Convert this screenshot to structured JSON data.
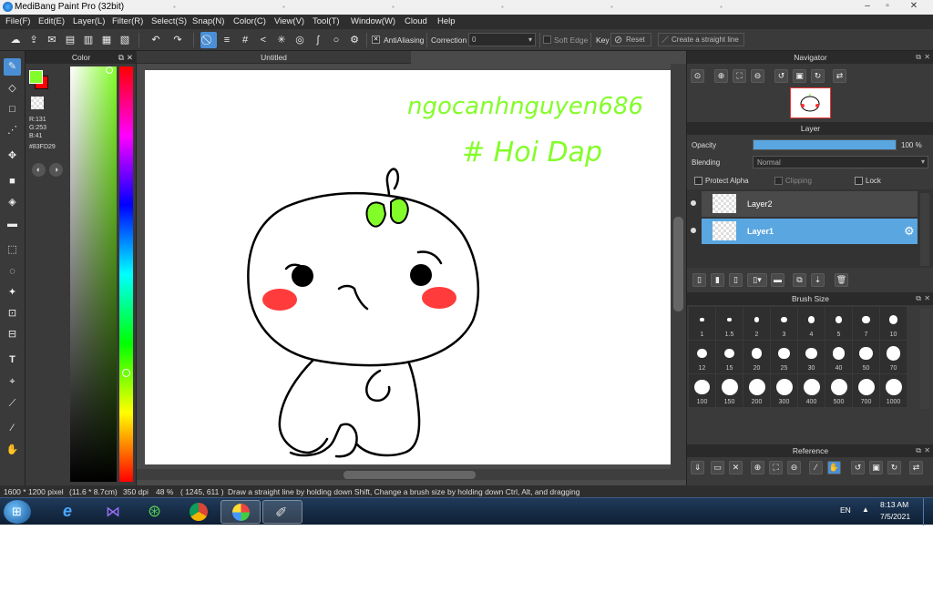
{
  "window": {
    "title": "MediBang Paint Pro (32bit)"
  },
  "menu": [
    "File(F)",
    "Edit(E)",
    "Layer(L)",
    "Filter(R)",
    "Select(S)",
    "Snap(N)",
    "Color(C)",
    "View(V)",
    "Tool(T)",
    "Window(W)",
    "Cloud",
    "Help"
  ],
  "toolbar": {
    "antialiasing_label": "AntiAliasing",
    "correction_label": "Correction",
    "correction_value": "0",
    "soft_edge_label": "Soft Edge",
    "key_label": "Key",
    "reset_label": "Reset",
    "straight_line_label": "Create a straight line"
  },
  "color_panel": {
    "title": "Color",
    "r": "R:131",
    "g": "G:253",
    "b": "B:41",
    "hex": "#83FD29",
    "primary_color": "#83FD29",
    "secondary_color": "#FF0000"
  },
  "canvas": {
    "doc_title": "Untitled",
    "text_line1": "ngocanhnguyen686",
    "text_line2": "# Hoi Dap"
  },
  "navigator": {
    "title": "Navigator"
  },
  "layer_panel": {
    "title": "Layer",
    "opacity_label": "Opacity",
    "opacity_value": "100 %",
    "opacity_fraction": 1.0,
    "blending_label": "Blending",
    "blending_value": "Normal",
    "protect_alpha_label": "Protect Alpha",
    "clipping_label": "Clipping",
    "lock_label": "Lock",
    "layers": [
      {
        "name": "Layer2",
        "selected": false
      },
      {
        "name": "Layer1",
        "selected": true
      }
    ]
  },
  "brush_size": {
    "title": "Brush Size",
    "sizes": [
      "1",
      "1.5",
      "2",
      "3",
      "4",
      "5",
      "7",
      "10",
      "12",
      "15",
      "20",
      "25",
      "30",
      "40",
      "50",
      "70",
      "100",
      "150",
      "200",
      "300",
      "400",
      "500",
      "700",
      "1000"
    ]
  },
  "reference": {
    "title": "Reference"
  },
  "status": {
    "size": "1600 * 1200 pixel",
    "cm": "(11.6 * 8.7cm)",
    "dpi": "350 dpi",
    "zoom": "48 %",
    "coords": "( 1245, 611 )",
    "hint": "Draw a straight line by holding down Shift, Change a brush size by holding down Ctrl, Alt, and dragging"
  },
  "taskbar": {
    "lang": "EN",
    "time": "8:13 AM",
    "date": "7/5/2021"
  }
}
